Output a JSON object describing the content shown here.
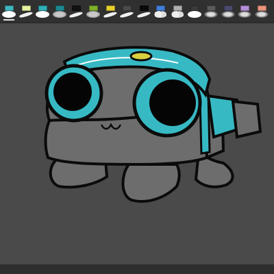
{
  "toolbar": {
    "selected_index": 0,
    "brushes": [
      {
        "icon": "round-brush-icon",
        "tip": "round",
        "color": "#3fb6c0"
      },
      {
        "icon": "pen-brush-icon",
        "tip": "pen",
        "color": "#e7f2a0"
      },
      {
        "icon": "round-brush-icon",
        "tip": "round",
        "color": "#2fb0b8"
      },
      {
        "icon": "smudge-brush-icon",
        "tip": "smudge",
        "color": "#1e8891"
      },
      {
        "icon": "pen-brush-icon",
        "tip": "pen",
        "color": "#111111"
      },
      {
        "icon": "smudge-brush-icon",
        "tip": "smudge",
        "color": "#7fb02a"
      },
      {
        "icon": "pen-brush-icon",
        "tip": "pen",
        "color": "#e6cf2d"
      },
      {
        "icon": "pen-brush-icon",
        "tip": "pen",
        "color": "#4a4a4a"
      },
      {
        "icon": "pen-brush-icon",
        "tip": "pen",
        "color": "#0a0a0a"
      },
      {
        "icon": "cloud-brush-icon",
        "tip": "cloud",
        "color": "#3f7fd6"
      },
      {
        "icon": "cloud-brush-icon",
        "tip": "cloud",
        "color": "#aeb0ad"
      },
      {
        "icon": "round-brush-icon",
        "tip": "round",
        "color": "#3a3a3a"
      },
      {
        "icon": "soft-brush-icon",
        "tip": "soft",
        "color": "#5a5a5a"
      },
      {
        "icon": "soft-brush-icon",
        "tip": "soft",
        "color": "#4c4a6e"
      },
      {
        "icon": "soft-brush-icon",
        "tip": "soft",
        "color": "#b48fd8"
      },
      {
        "icon": "soft-brush-icon",
        "tip": "soft",
        "color": "#e8957a"
      }
    ]
  },
  "drawing": {
    "body_color": "#6d6d6d",
    "outline_color": "#0b0b0b",
    "accent_color": "#37b9c4",
    "lens_color": "#050505",
    "badge_color": "#d8d041",
    "shadow_color": "#5b5b5b"
  }
}
